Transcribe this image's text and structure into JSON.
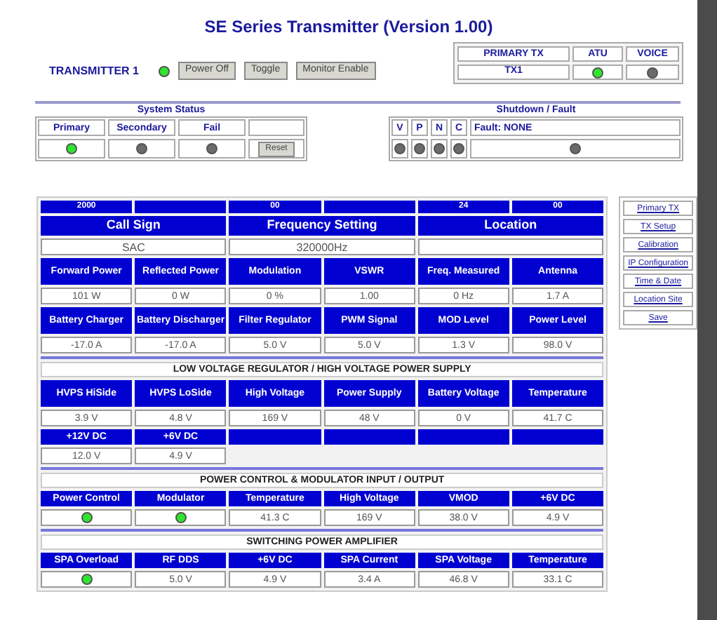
{
  "title": "SE Series Transmitter (Version 1.00)",
  "transmitter": {
    "label": "TRANSMITTER 1",
    "on": true,
    "buttons": [
      "Power Off",
      "Toggle",
      "Monitor Enable"
    ]
  },
  "primary_box": {
    "columns": [
      {
        "label": "PRIMARY TX",
        "kind": "text",
        "value": "TX1"
      },
      {
        "label": "ATU",
        "kind": "led",
        "on": true
      },
      {
        "label": "VOICE",
        "kind": "led",
        "on": false
      }
    ]
  },
  "system_status": {
    "title": "System Status",
    "columns": [
      {
        "label": "Primary",
        "on": true
      },
      {
        "label": "Secondary",
        "on": false
      },
      {
        "label": "Fail",
        "on": false
      }
    ],
    "button": "Reset"
  },
  "shutdown": {
    "title": "Shutdown / Fault",
    "columns": [
      {
        "label": "V",
        "on": false
      },
      {
        "label": "P",
        "on": false
      },
      {
        "label": "N",
        "on": false
      },
      {
        "label": "C",
        "on": false
      }
    ],
    "fault": {
      "label": "Fault: NONE",
      "on": false
    }
  },
  "date_row": [
    {
      "kind": "text",
      "text": "2000"
    },
    {
      "kind": "blank"
    },
    {
      "kind": "text",
      "text": "00"
    },
    {
      "kind": "blank"
    },
    {
      "kind": "text",
      "text": "24"
    },
    {
      "kind": "text",
      "text": "00"
    }
  ],
  "info": [
    {
      "header": "Call Sign",
      "value": "SAC"
    },
    {
      "header": "Frequency Setting",
      "value": "320000Hz"
    },
    {
      "header": "Location"
    }
  ],
  "blocks": [
    {
      "kind": "grid",
      "cells": [
        {
          "label": "Forward Power",
          "kind": "text",
          "value": "101 W"
        },
        {
          "label": "Reflected Power",
          "kind": "text",
          "value": "0 W"
        },
        {
          "label": "Modulation",
          "kind": "text",
          "value": "0 %"
        },
        {
          "label": "VSWR",
          "kind": "text",
          "value": "1.00"
        },
        {
          "label": "Freq. Measured",
          "kind": "text",
          "value": "0 Hz"
        },
        {
          "label": "Antenna",
          "kind": "text",
          "value": "1.7 A"
        }
      ]
    },
    {
      "kind": "grid",
      "cells": [
        {
          "label": "Battery Charger",
          "kind": "text",
          "value": "-17.0 A"
        },
        {
          "label": "Battery Discharger",
          "kind": "text",
          "value": "-17.0 A"
        },
        {
          "label": "Filter Regulator",
          "kind": "text",
          "value": "5.0 V"
        },
        {
          "label": "PWM Signal",
          "kind": "text",
          "value": "5.0 V"
        },
        {
          "label": "MOD Level",
          "kind": "text",
          "value": "1.3 V"
        },
        {
          "label": "Power Level",
          "kind": "text",
          "value": "98.0 V"
        }
      ]
    },
    {
      "kind": "section",
      "title": "LOW VOLTAGE REGULATOR / HIGH VOLTAGE POWER SUPPLY"
    },
    {
      "kind": "grid",
      "cells": [
        {
          "label": "HVPS HiSide",
          "kind": "text",
          "value": "3.9 V"
        },
        {
          "label": "HVPS LoSide",
          "kind": "text",
          "value": "4.8 V"
        },
        {
          "label": "High Voltage",
          "kind": "text",
          "value": "169 V"
        },
        {
          "label": "Power Supply",
          "kind": "text",
          "value": "48 V"
        },
        {
          "label": "Battery Voltage",
          "kind": "text",
          "value": "0 V"
        },
        {
          "label": "Temperature",
          "kind": "text",
          "value": "41.7 C"
        }
      ]
    },
    {
      "kind": "row",
      "cells": [
        {
          "label": "+12V DC",
          "kind": "text",
          "value": "12.0 V"
        },
        {
          "label": "+6V DC",
          "kind": "text",
          "value": "4.9 V"
        },
        {
          "kind": "blank"
        },
        {
          "kind": "blank"
        },
        {
          "kind": "blank"
        },
        {
          "kind": "blank"
        }
      ]
    },
    {
      "kind": "section",
      "title": "POWER CONTROL & MODULATOR INPUT / OUTPUT"
    },
    {
      "kind": "row",
      "cells": [
        {
          "label": "Power Control",
          "kind": "led",
          "on": true
        },
        {
          "label": "Modulator",
          "kind": "led",
          "on": true
        },
        {
          "label": "Temperature",
          "kind": "text",
          "value": "41.3 C"
        },
        {
          "label": "High Voltage",
          "kind": "text",
          "value": "169 V"
        },
        {
          "label": "VMOD",
          "kind": "text",
          "value": "38.0 V"
        },
        {
          "label": "+6V DC",
          "kind": "text",
          "value": "4.9 V"
        }
      ]
    },
    {
      "kind": "section",
      "title": "SWITCHING POWER AMPLIFIER"
    },
    {
      "kind": "row",
      "cells": [
        {
          "label": "SPA Overload",
          "kind": "led",
          "on": true
        },
        {
          "label": "RF DDS",
          "kind": "text",
          "value": "5.0 V"
        },
        {
          "label": "+6V DC",
          "kind": "text",
          "value": "4.9 V"
        },
        {
          "label": "SPA Current",
          "kind": "text",
          "value": "3.4 A"
        },
        {
          "label": "SPA Voltage",
          "kind": "text",
          "value": "46.8 V"
        },
        {
          "label": "Temperature",
          "kind": "text",
          "value": "33.1 C"
        }
      ]
    }
  ],
  "nav": [
    "Primary TX",
    "TX Setup",
    "Calibration",
    "IP Configuration",
    "Time & Date",
    "Location Site",
    "Save"
  ]
}
